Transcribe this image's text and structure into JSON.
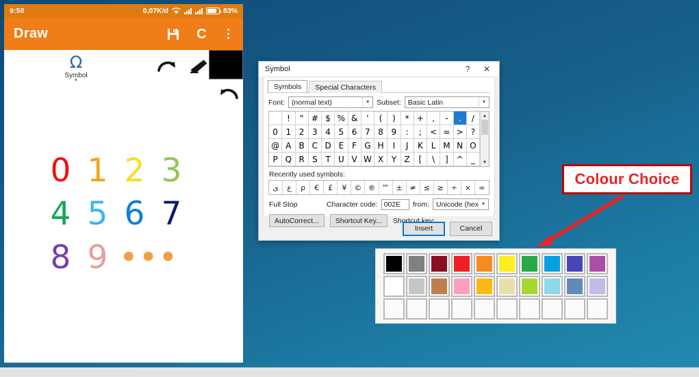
{
  "phone": {
    "status_bar": {
      "clock": "9:50",
      "data_rate": "0,07K/d",
      "battery_percent": "83%",
      "icons": [
        "wifi-icon",
        "signal-bars-icon",
        "signal-bars-icon",
        "battery-icon"
      ]
    },
    "app_bar": {
      "title": "Draw",
      "save_icon": "save-icon",
      "clear_label": "C",
      "overflow_icon": "kebab-menu-icon"
    },
    "toolbar": {
      "symbol_glyph": "Ω",
      "symbol_label": "Symbol",
      "symbol_caret": "▾",
      "redo_icon": "redo-arrow-icon",
      "eraser_icon": "eraser-icon",
      "undo_icon": "undo-arrow-icon",
      "current_color": "#000000"
    },
    "canvas": {
      "rows": [
        [
          {
            "char": "0",
            "color": "#f01010"
          },
          {
            "char": "1",
            "color": "#f2a41c"
          },
          {
            "char": "2",
            "color": "#f5e020"
          },
          {
            "char": "3",
            "color": "#93c553"
          }
        ],
        [
          {
            "char": "4",
            "color": "#12a85a"
          },
          {
            "char": "5",
            "color": "#38b6ef"
          },
          {
            "char": "6",
            "color": "#0b7fd4"
          },
          {
            "char": "7",
            "color": "#0a1b6e"
          }
        ],
        [
          {
            "char": "8",
            "color": "#7b3ea8"
          },
          {
            "char": "9",
            "color": "#e6a0a0"
          },
          {
            "char": "•••",
            "color": "#f0a043"
          }
        ]
      ]
    }
  },
  "symbol_dialog": {
    "title": "Symbol",
    "help_icon": "?",
    "close_icon": "✕",
    "tabs": [
      {
        "label": "Symbols",
        "active": true
      },
      {
        "label": "Special Characters",
        "active": false
      }
    ],
    "font_label": "Font:",
    "font_value": "(normal text)",
    "subset_label": "Subset:",
    "subset_value": "Basic Latin",
    "grid_chars": [
      " ",
      "!",
      "\"",
      "#",
      "$",
      "%",
      "&",
      "'",
      "(",
      ")",
      "*",
      "+",
      ",",
      "-",
      ".",
      "/",
      "0",
      "1",
      "2",
      "3",
      "4",
      "5",
      "6",
      "7",
      "8",
      "9",
      ":",
      ";",
      "<",
      "=",
      ">",
      "?",
      "@",
      "A",
      "B",
      "C",
      "D",
      "E",
      "F",
      "G",
      "H",
      "I",
      "J",
      "K",
      "L",
      "M",
      "N",
      "O",
      "P",
      "Q",
      "R",
      "S",
      "T",
      "U",
      "V",
      "W",
      "X",
      "Y",
      "Z",
      "[",
      "\\",
      "]",
      "^",
      "_"
    ],
    "selected_char": ".",
    "selected_index": 14,
    "recent_label": "Recently used symbols:",
    "recent_chars": [
      "ى",
      "ع",
      "ρ",
      "€",
      "£",
      "¥",
      "©",
      "®",
      "™",
      "±",
      "≠",
      "≤",
      "≥",
      "÷",
      "×",
      "∞"
    ],
    "character_name": "Full Stop",
    "charcode_label": "Character code:",
    "charcode_value": "002E",
    "from_label": "from:",
    "from_value": "Unicode (hex)",
    "autocorrect_label": "AutoCorrect...",
    "shortcut_key_button": "Shortcut Key...",
    "shortcut_key_label": "Shortcut key:",
    "insert_label": "Insert",
    "cancel_label": "Cancel"
  },
  "palette": {
    "rows": [
      [
        "#000000",
        "#808080",
        "#8b0f23",
        "#ee2026",
        "#f68b1f",
        "#fdee21",
        "#27a94a",
        "#06a0e0",
        "#4a45ba",
        "#ab4fa8"
      ],
      [
        "#ffffff",
        "#c6c6c6",
        "#bd7f50",
        "#f9a0bc",
        "#fcb813",
        "#e9dfa8",
        "#a7d72e",
        "#8fd8e8",
        "#6389b8",
        "#c1bbe5"
      ],
      [
        "",
        "",
        "",
        "",
        "",
        "",
        "",
        "",
        "",
        ""
      ]
    ]
  },
  "annotation": {
    "text": "Colour Choice",
    "box_border_color": "#c00000",
    "text_color": "#e8232a",
    "arrow_color": "#e8232a",
    "arrow_icon": "arrow-pointing-down-left-icon"
  }
}
